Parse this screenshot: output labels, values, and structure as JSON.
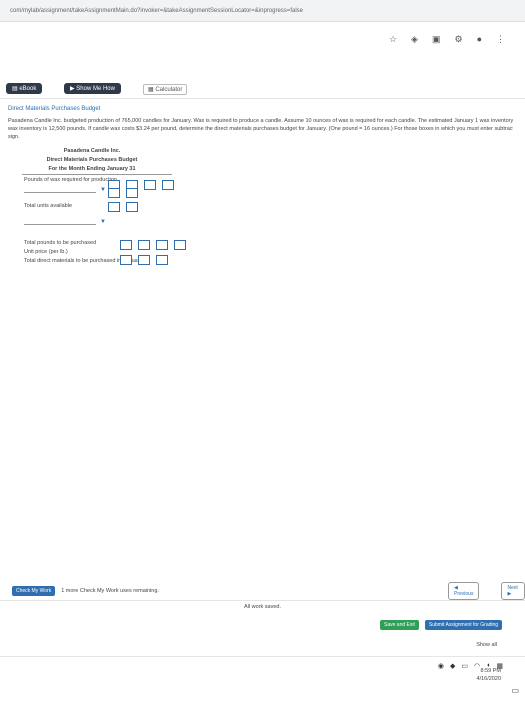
{
  "browser": {
    "url": "com/mylab/assignment/takeAssignmentMain.do?invoker=&takeAssignmentSessionLocator=&inprogress=false"
  },
  "toolbar": {
    "ebook_label": "eBook",
    "show_me_how_label": "Show Me How",
    "calculator_label": "Calculator"
  },
  "problem": {
    "title": "Direct Materials Purchases Budget",
    "body_line1": "Pasadena Candle Inc. budgeted production of 765,000 candles for January. Wax is required to produce a candle. Assume 10 ounces of wax is required for each candle. The estimated January 1 wax inventory is 16,000 pounds. The desired January 31",
    "body_line2": "wax inventory is 12,500 pounds. If candle wax costs $3.24 per pound, determine the direct materials purchases budget for January. (One pound = 16 ounces.) For those boxes in which you must enter subtracted or negative numbers use a minus",
    "body_line3": "sign."
  },
  "budget": {
    "company": "Pasadena Candle Inc.",
    "name": "Direct Materials Purchases Budget",
    "period": "For the Month Ending January 31",
    "row1_label": "Pounds of wax required for production",
    "row2_label": "",
    "row3_label": "Total units available",
    "row4_label": "",
    "row5_label": "Total pounds to be purchased",
    "row6_label": "Unit price (per lb.)",
    "row7_label": "Total direct materials to be purchased in January"
  },
  "actions": {
    "check_work_label": "Check My Work",
    "check_work_remaining": "1 more Check My Work uses remaining.",
    "all_work_saved": "All work saved.",
    "save_exit_label": "Save and Exit",
    "submit_label": "Submit Assignment for Grading",
    "previous_label": "Previous",
    "next_label": "Next",
    "show_all_label": "Show all"
  },
  "clock": {
    "time": "8:59 PM",
    "date": "4/16/2020"
  }
}
